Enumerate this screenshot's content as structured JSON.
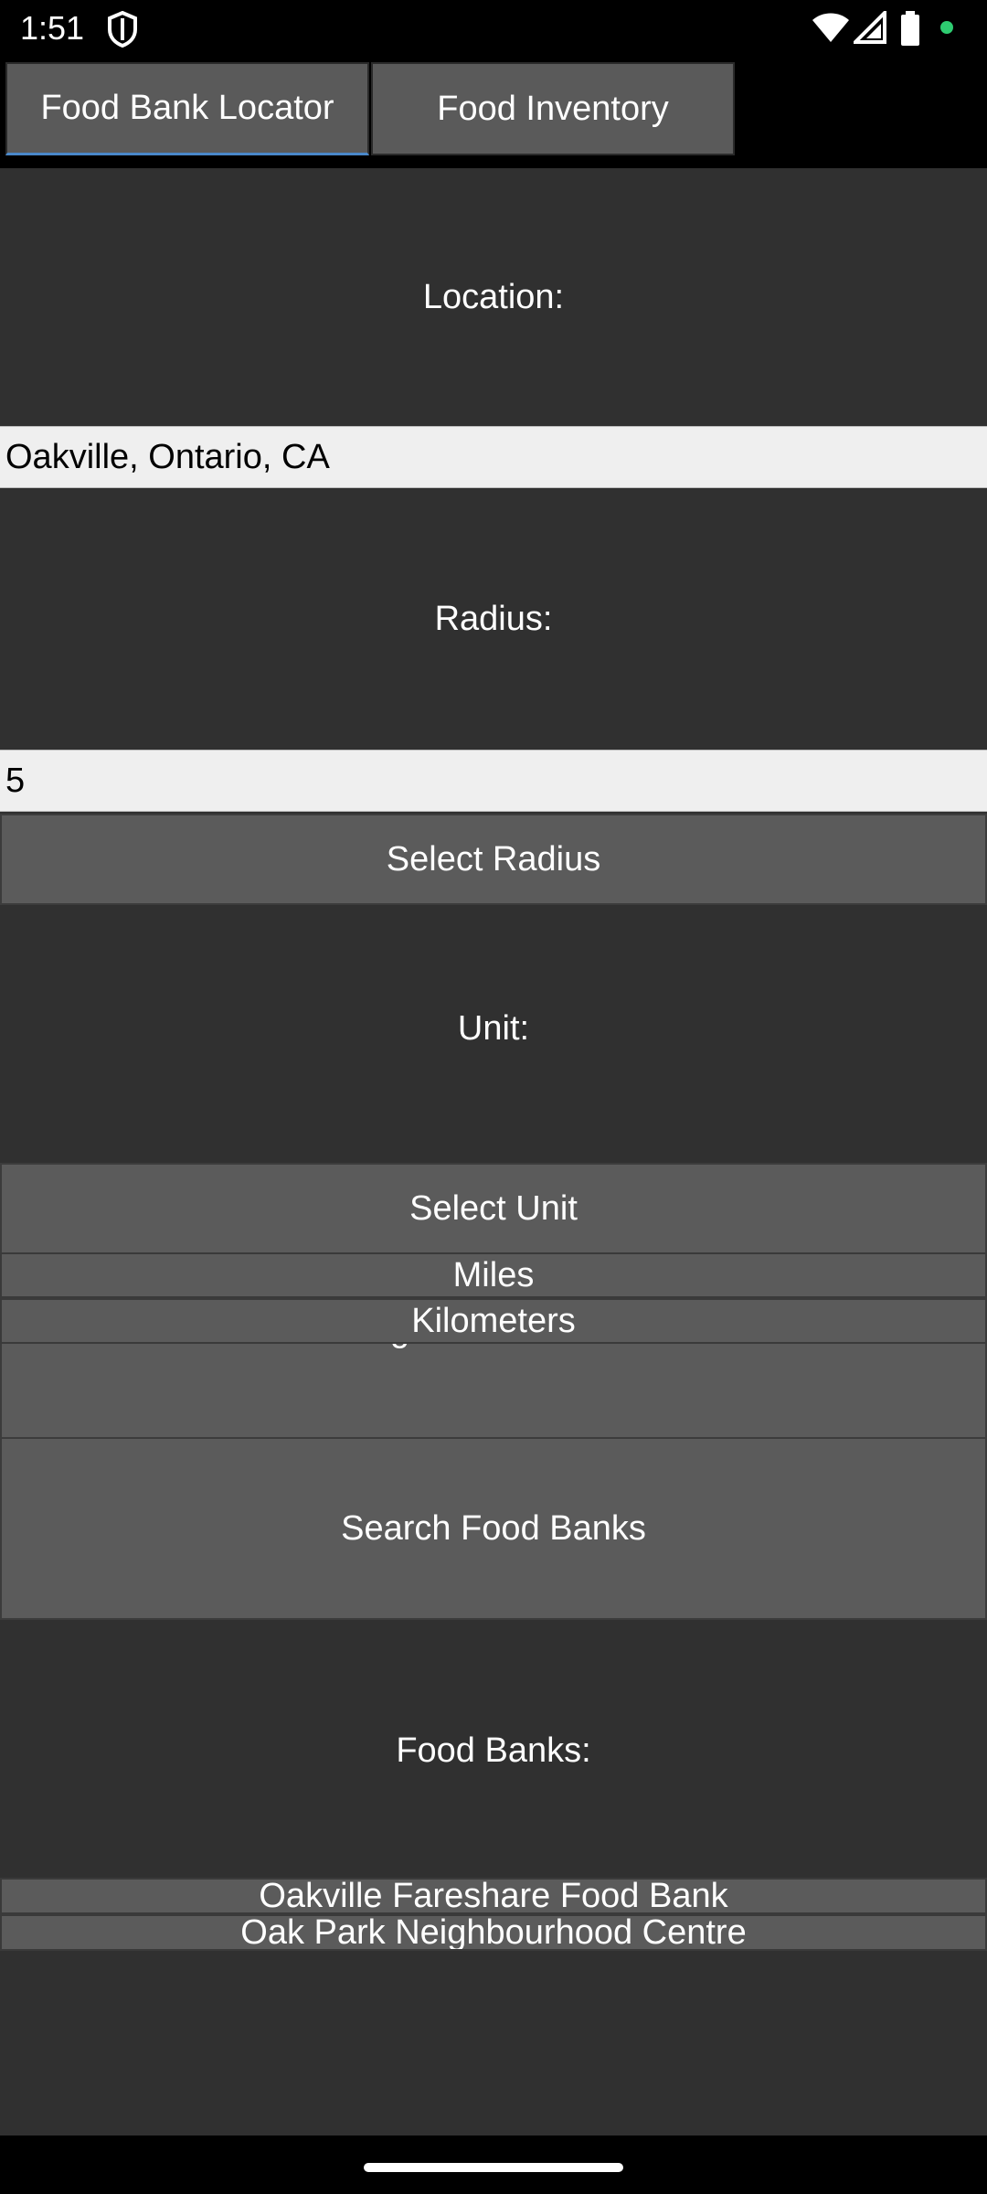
{
  "status_bar": {
    "time": "1:51",
    "icons": [
      "shield-icon",
      "wifi-icon",
      "signal-icon",
      "battery-icon",
      "dot-icon"
    ],
    "dot_color": "#2ecc71"
  },
  "tabs": [
    {
      "label": "Food Bank Locator",
      "active": true
    },
    {
      "label": "Food Inventory",
      "active": false
    }
  ],
  "form": {
    "location_label": "Location:",
    "location_value": "Oakville, Ontario, CA",
    "radius_label": "Radius:",
    "radius_value": "5",
    "select_radius_label": "Select Radius",
    "unit_label": "Unit:",
    "select_unit_label": "Select Unit",
    "unit_options": [
      "Miles",
      "Kilometers"
    ],
    "autogenerate_label": "Autogenerate Location",
    "search_label": "Search Food Banks"
  },
  "results": {
    "label": "Food Banks:",
    "items": [
      "Oakville Fareshare Food Bank",
      "Oak Park Neighbourhood Centre"
    ]
  },
  "colors": {
    "background": "#303030",
    "button": "#5b5b5b",
    "input": "#efefef",
    "tab_indicator": "#4a88c9"
  }
}
